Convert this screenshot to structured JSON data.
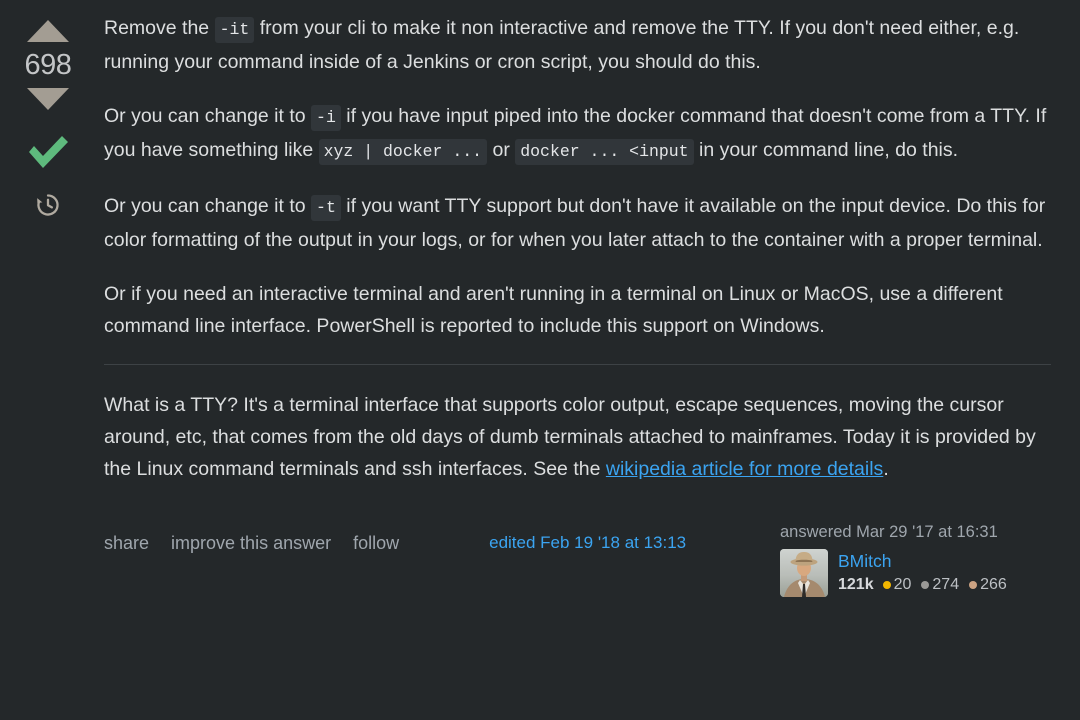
{
  "theme": {
    "background": "#24282a",
    "text": "#dcdedf",
    "link": "#3ba4f1",
    "muted": "#9fa6ad",
    "code_background": "#31363a",
    "vote_arrow": "#a39d93",
    "accepted_check": "#5eba7d",
    "gold": "#f1b600",
    "silver": "#9a9996",
    "bronze": "#cca383"
  },
  "vote": {
    "upvote_name": "upvote",
    "downvote_name": "downvote",
    "score": "698",
    "accepted_label": "Accepted answer",
    "history_label": "Timeline"
  },
  "post": {
    "paragraphs": [
      {
        "id": "p1",
        "parts": [
          {
            "type": "text",
            "value": "Remove the "
          },
          {
            "type": "code",
            "value": "-it"
          },
          {
            "type": "text",
            "value": " from your cli to make it non interactive and remove the TTY. If you don't need either, e.g. running your command inside of a Jenkins or cron script, you should do this."
          }
        ]
      },
      {
        "id": "p2",
        "parts": [
          {
            "type": "text",
            "value": "Or you can change it to "
          },
          {
            "type": "code",
            "value": "-i"
          },
          {
            "type": "text",
            "value": " if you have input piped into the docker command that doesn't come from a TTY. If you have something like "
          },
          {
            "type": "code",
            "value": "xyz | docker ..."
          },
          {
            "type": "text",
            "value": " or "
          },
          {
            "type": "code",
            "value": "docker ... <input"
          },
          {
            "type": "text",
            "value": " in your command line, do this."
          }
        ]
      },
      {
        "id": "p3",
        "parts": [
          {
            "type": "text",
            "value": "Or you can change it to "
          },
          {
            "type": "code",
            "value": "-t"
          },
          {
            "type": "text",
            "value": " if you want TTY support but don't have it available on the input device. Do this for color formatting of the output in your logs, or for when you later attach to the container with a proper terminal."
          }
        ]
      },
      {
        "id": "p4",
        "parts": [
          {
            "type": "text",
            "value": "Or if you need an interactive terminal and aren't running in a terminal on Linux or MacOS, use a different command line interface. PowerShell is reported to include this support on Windows."
          }
        ]
      },
      {
        "id": "divider",
        "parts": []
      },
      {
        "id": "p5",
        "parts": [
          {
            "type": "text",
            "value": "What is a TTY? It's a terminal interface that supports color output, escape sequences, moving the cursor around, etc, that comes from the old days of dumb terminals attached to mainframes. Today it is provided by the Linux command terminals and ssh interfaces. See the "
          },
          {
            "type": "link",
            "value": "wikipedia article for more details"
          },
          {
            "type": "text",
            "value": "."
          }
        ]
      }
    ]
  },
  "footer": {
    "actions": [
      {
        "name": "share",
        "label": "share"
      },
      {
        "name": "improve-this-answer",
        "label": "improve this answer"
      },
      {
        "name": "follow",
        "label": "follow"
      }
    ],
    "edited": "edited Feb 19 '18 at 13:13",
    "user": {
      "action_time": "answered Mar 29 '17 at 16:31",
      "name": "BMitch",
      "reputation": "121k",
      "badges": {
        "gold": "20",
        "silver": "274",
        "bronze": "266"
      },
      "avatar_alt": "BMitch avatar"
    }
  }
}
